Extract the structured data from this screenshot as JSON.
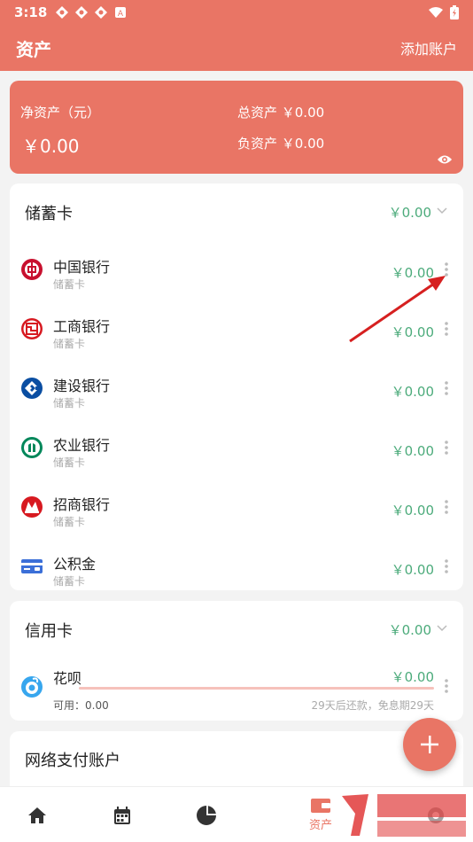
{
  "status_bar": {
    "time": "3:18"
  },
  "app_bar": {
    "title": "资产",
    "action": "添加账户"
  },
  "summary": {
    "net_label": "净资产（元）",
    "net_value": "￥0.00",
    "total_label": "总资产 ￥0.00",
    "debt_label": "负资产 ￥0.00"
  },
  "savings": {
    "title": "储蓄卡",
    "amount": "￥0.00",
    "items": [
      {
        "name": "中国银行",
        "type": "储蓄卡",
        "amount": "￥0.00",
        "icon": "boc-icon",
        "color": "#c8102e"
      },
      {
        "name": "工商银行",
        "type": "储蓄卡",
        "amount": "￥0.00",
        "icon": "icbc-icon",
        "color": "#d71920"
      },
      {
        "name": "建设银行",
        "type": "储蓄卡",
        "amount": "￥0.00",
        "icon": "ccb-icon",
        "color": "#0a4ea2"
      },
      {
        "name": "农业银行",
        "type": "储蓄卡",
        "amount": "￥0.00",
        "icon": "abc-icon",
        "color": "#00875a"
      },
      {
        "name": "招商银行",
        "type": "储蓄卡",
        "amount": "￥0.00",
        "icon": "cmb-icon",
        "color": "#d71920"
      },
      {
        "name": "公积金",
        "type": "储蓄卡",
        "amount": "￥0.00",
        "icon": "card-icon",
        "color": "#3b6fd8"
      }
    ]
  },
  "credit": {
    "title": "信用卡",
    "amount": "￥0.00",
    "item": {
      "name": "花呗",
      "amount": "￥0.00",
      "available": "可用：0.00",
      "repay": "29天后还款，免息期29天",
      "progress": 0,
      "icon": "huabei-icon"
    }
  },
  "online": {
    "title": "网络支付账户"
  },
  "bottom_nav": {
    "active_label": "资产"
  },
  "colors": {
    "primary": "#e97565",
    "amount_green": "#4cab7b"
  }
}
